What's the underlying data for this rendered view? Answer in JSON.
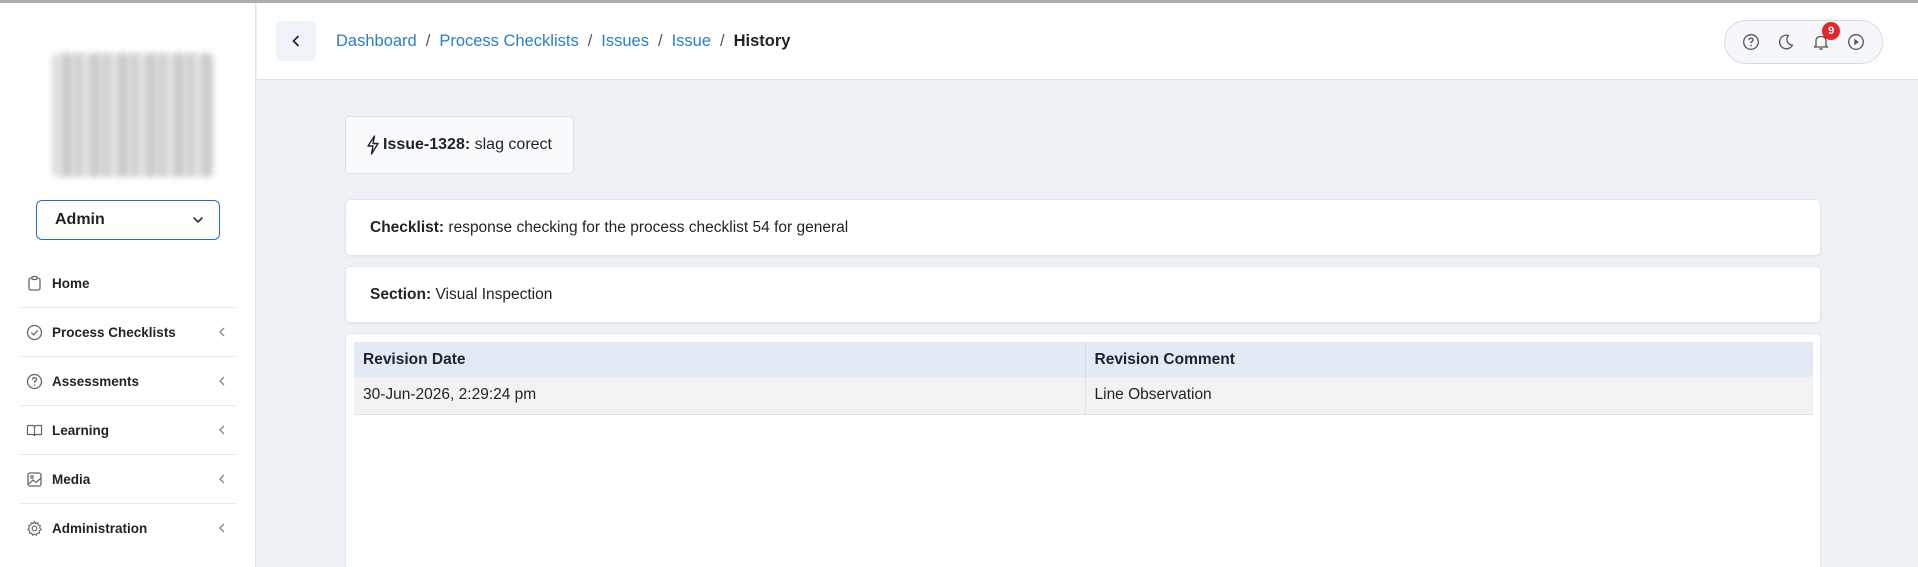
{
  "sidebar": {
    "role": "Admin",
    "items": [
      {
        "label": "Home",
        "icon": "clipboard-icon"
      },
      {
        "label": "Process Checklists",
        "icon": "check-circle-icon"
      },
      {
        "label": "Assessments",
        "icon": "question-circle-icon"
      },
      {
        "label": "Learning",
        "icon": "book-icon"
      },
      {
        "label": "Media",
        "icon": "image-icon"
      },
      {
        "label": "Administration",
        "icon": "gear-icon"
      }
    ]
  },
  "header": {
    "breadcrumb": [
      "Dashboard",
      "Process Checklists",
      "Issues",
      "Issue"
    ],
    "breadcrumb_current": "History",
    "notification_count": "9"
  },
  "issue": {
    "id_label": "Issue-1328:",
    "title": "slag corect"
  },
  "checklist": {
    "label": "Checklist:",
    "value": "response checking for the process checklist 54 for general"
  },
  "section": {
    "label": "Section:",
    "value": "Visual Inspection"
  },
  "history_table": {
    "columns": [
      "Revision Date",
      "Revision Comment"
    ],
    "rows": [
      [
        "30-Jun-2026, 2:29:24 pm",
        "Line Observation"
      ]
    ]
  },
  "colors": {
    "accent": "#2b7fc4",
    "badge": "#e5252a",
    "table_header": "#e3eaf5"
  }
}
